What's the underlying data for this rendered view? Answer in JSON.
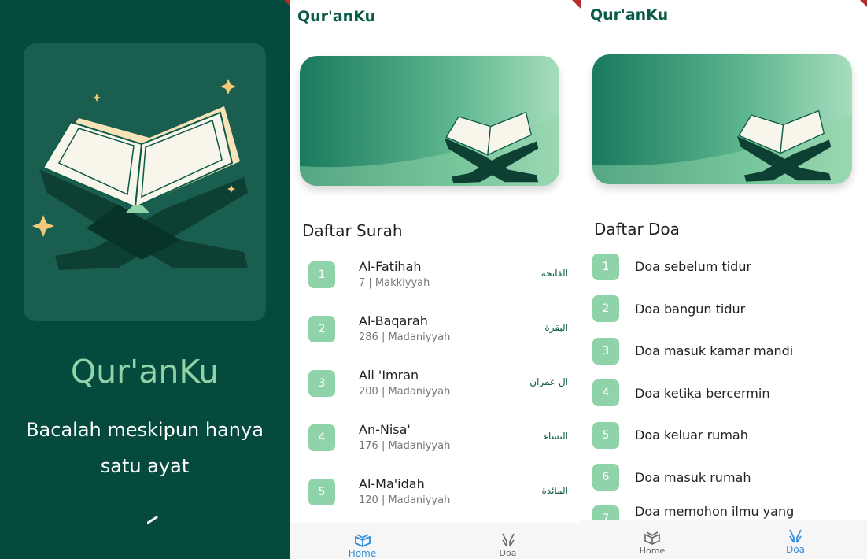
{
  "splash": {
    "title": "Qur'anKu",
    "subtitle_line1": "Bacalah meskipun hanya",
    "subtitle_line2": "satu ayat"
  },
  "home": {
    "app_title": "Qur'anKu",
    "section_title": "Daftar Surah",
    "surahs": [
      {
        "number": "1",
        "name": "Al-Fatihah",
        "meta": "7 | Makkiyyah",
        "arabic": "الفاتحة"
      },
      {
        "number": "2",
        "name": "Al-Baqarah",
        "meta": "286 | Madaniyyah",
        "arabic": "البقرة"
      },
      {
        "number": "3",
        "name": "Ali 'Imran",
        "meta": "200 | Madaniyyah",
        "arabic": "ال عمران"
      },
      {
        "number": "4",
        "name": "An-Nisa'",
        "meta": "176 | Madaniyyah",
        "arabic": "النساء"
      },
      {
        "number": "5",
        "name": "Al-Ma'idah",
        "meta": "120 | Madaniyyah",
        "arabic": "المائدة"
      }
    ],
    "nav": {
      "home": "Home",
      "doa": "Doa",
      "active": "home"
    }
  },
  "doa": {
    "app_title": "Qur'anKu",
    "section_title": "Daftar Doa",
    "items": [
      {
        "number": "1",
        "name": "Doa sebelum tidur"
      },
      {
        "number": "2",
        "name": "Doa bangun tidur"
      },
      {
        "number": "3",
        "name": "Doa masuk kamar mandi"
      },
      {
        "number": "4",
        "name": "Doa ketika bercermin"
      },
      {
        "number": "5",
        "name": "Doa keluar rumah"
      },
      {
        "number": "6",
        "name": "Doa masuk rumah"
      },
      {
        "number": "7",
        "name": "Doa memohon ilmu yang"
      }
    ],
    "nav": {
      "home": "Home",
      "doa": "Doa",
      "active": "doa"
    }
  },
  "colors": {
    "primary_dark": "#054a3c",
    "accent_green": "#8fd4a8",
    "nav_active": "#2f8fe0"
  },
  "icons": {
    "hero": "open-quran-on-stand",
    "home_nav": "quran-home-icon",
    "doa_nav": "praying-hands-icon"
  }
}
